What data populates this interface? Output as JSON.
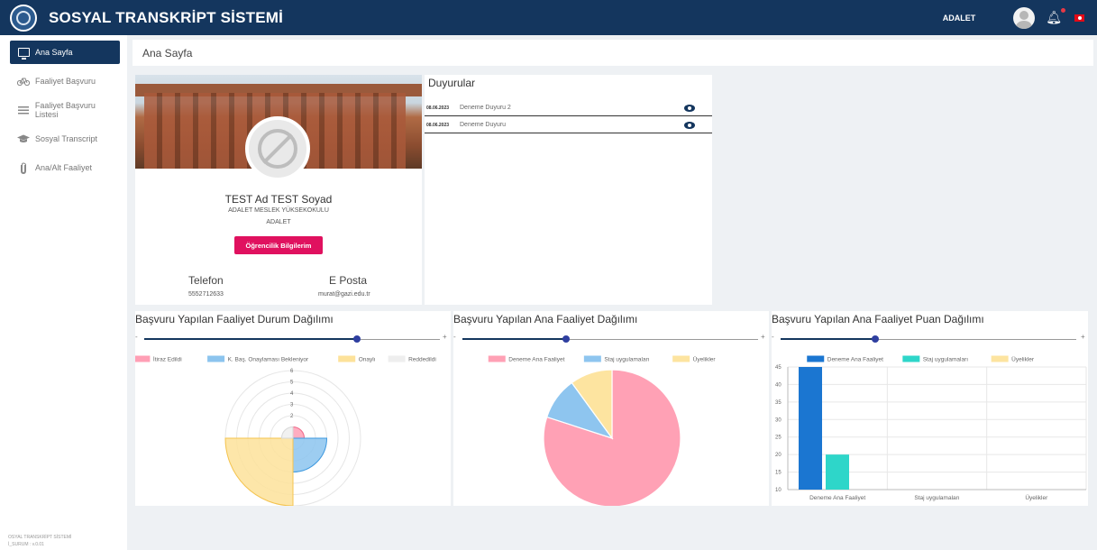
{
  "header": {
    "title": "SOSYAL TRANSKRİPT SİSTEMİ",
    "user": "ADALET"
  },
  "sidebar": {
    "items": [
      {
        "label": "Ana Sayfa",
        "icon": "monitor-icon",
        "active": true
      },
      {
        "label": "Faaliyet Başvuru",
        "icon": "bicycle-icon",
        "active": false
      },
      {
        "label": "Faaliyet Başvuru Listesi",
        "icon": "list-icon",
        "active": false
      },
      {
        "label": "Sosyal Transcript",
        "icon": "graduation-cap-icon",
        "active": false
      },
      {
        "label": "Ana/Alt Faaliyet",
        "icon": "paperclip-icon",
        "active": false
      }
    ],
    "footer_line1": "OSYAL TRANSKRİPT SİSTEMİ",
    "footer_line2": "İ_SURUM : v.0.01"
  },
  "breadcrumb": "Ana Sayfa",
  "profile": {
    "name": "TEST Ad TEST Soyad",
    "school": "ADALET MESLEK YÜKSEKOKULU",
    "department": "ADALET",
    "button_label": "Öğrencilik Bilgilerim",
    "phone_label": "Telefon",
    "phone": "5552712633",
    "email_label": "E Posta",
    "email": "murat@gazi.edu.tr"
  },
  "announcements": {
    "title": "Duyurular",
    "items": [
      {
        "date": "08.06.2023",
        "text": "Deneme Duyuru 2"
      },
      {
        "date": "08.06.2023",
        "text": "Deneme Duyuru"
      }
    ]
  },
  "charts": {
    "status": {
      "title": "Başvuru Yapılan Faaliyet Durum Dağılımı",
      "slider_value": 0.72
    },
    "main": {
      "title": "Başvuru Yapılan Ana Faaliyet Dağılımı",
      "slider_value": 0.35
    },
    "points": {
      "title": "Başvuru Yapılan Ana Faaliyet Puan Dağılımı",
      "slider_value": 0.32
    },
    "slider_minus": "-",
    "slider_plus": "+"
  },
  "chart_data": [
    {
      "type": "polarArea",
      "labels": [
        "İtiraz Edildi",
        "K. Baş. Onaylaması Bekleniyor",
        "Onaylı",
        "Reddedildi"
      ],
      "values": [
        1,
        3,
        6,
        1
      ],
      "colors": [
        "#ff9fb5",
        "#8cc4ee",
        "#fde29a",
        "#eeeeee"
      ],
      "r_ticks": [
        1,
        2,
        3,
        4,
        5,
        6
      ],
      "r_ticks_shown": [
        2,
        3,
        4,
        5,
        6
      ],
      "rmax": 6,
      "legend": "top"
    },
    {
      "type": "pie",
      "labels": [
        "Deneme Ana Faaliyet",
        "Staj uygulamaları",
        "Üyelikler"
      ],
      "values": [
        80,
        10,
        10
      ],
      "colors": [
        "#ffa1b5",
        "#8ec5ef",
        "#fde4a0"
      ],
      "legend": "top"
    },
    {
      "type": "bar",
      "categories": [
        "Deneme Ana Faaliyet",
        "Staj uygulamaları",
        "Üyelikler"
      ],
      "series": [
        {
          "name": "Deneme Ana Faaliyet",
          "values": [
            45,
            0,
            0
          ],
          "color": "#1b76d1"
        },
        {
          "name": "Staj uygulamaları",
          "values": [
            20,
            0,
            0
          ],
          "color": "#2ed6c9"
        },
        {
          "name": "Üyelikler",
          "values": [
            0,
            0,
            0
          ],
          "color": "#fde4a0"
        }
      ],
      "ylim": [
        10,
        45
      ],
      "yticks": [
        10,
        15,
        20,
        25,
        30,
        35,
        40,
        45
      ],
      "legend": "top"
    }
  ]
}
